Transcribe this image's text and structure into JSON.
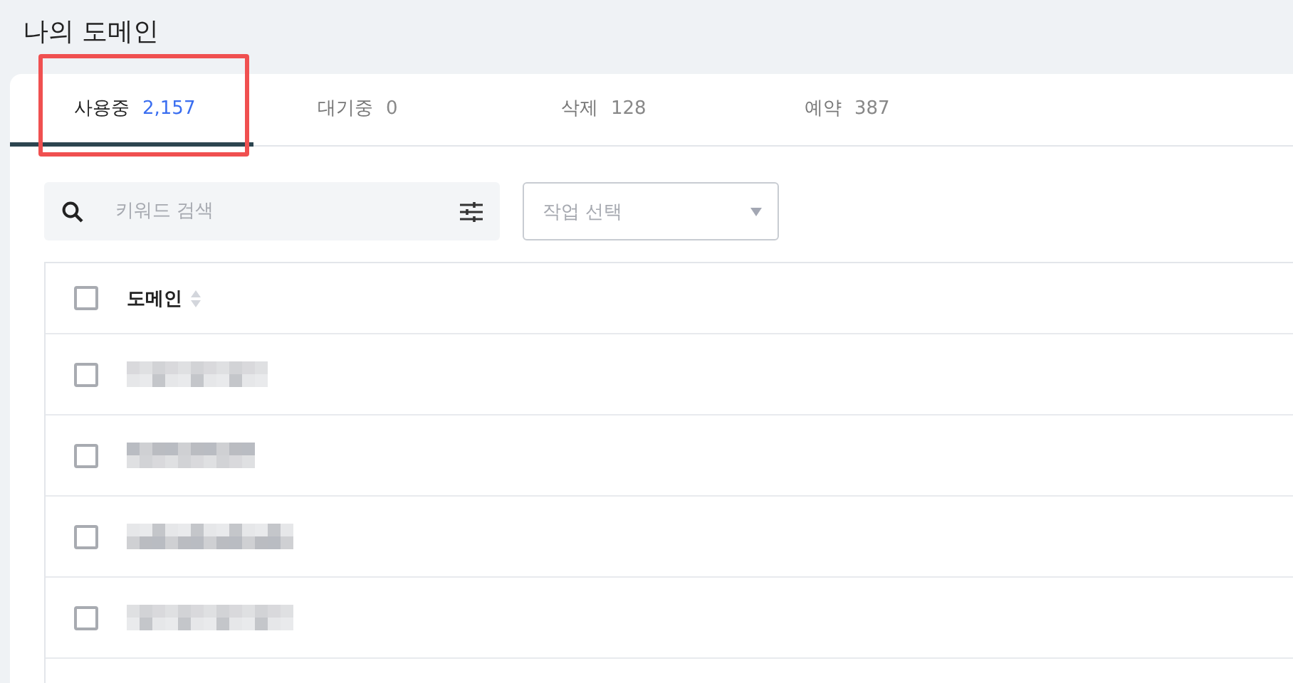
{
  "page_title": "나의 도메인",
  "tabs": [
    {
      "label": "사용중",
      "count": "2,157",
      "selected": true,
      "highlighted": true
    },
    {
      "label": "대기중",
      "count": "0",
      "selected": false,
      "highlighted": false
    },
    {
      "label": "삭제",
      "count": "128",
      "selected": false,
      "highlighted": false
    },
    {
      "label": "예약",
      "count": "387",
      "selected": false,
      "highlighted": false
    }
  ],
  "search": {
    "placeholder": "키워드 검색"
  },
  "action_select": {
    "placeholder": "작업 선택"
  },
  "table": {
    "select_all_checked": false,
    "columns": [
      {
        "label": "도메인"
      }
    ],
    "rows": [
      {
        "checked": false,
        "kind": "blurred"
      },
      {
        "checked": false,
        "kind": "blurred"
      },
      {
        "checked": false,
        "kind": "blurred"
      },
      {
        "checked": false,
        "kind": "blurred"
      }
    ]
  }
}
